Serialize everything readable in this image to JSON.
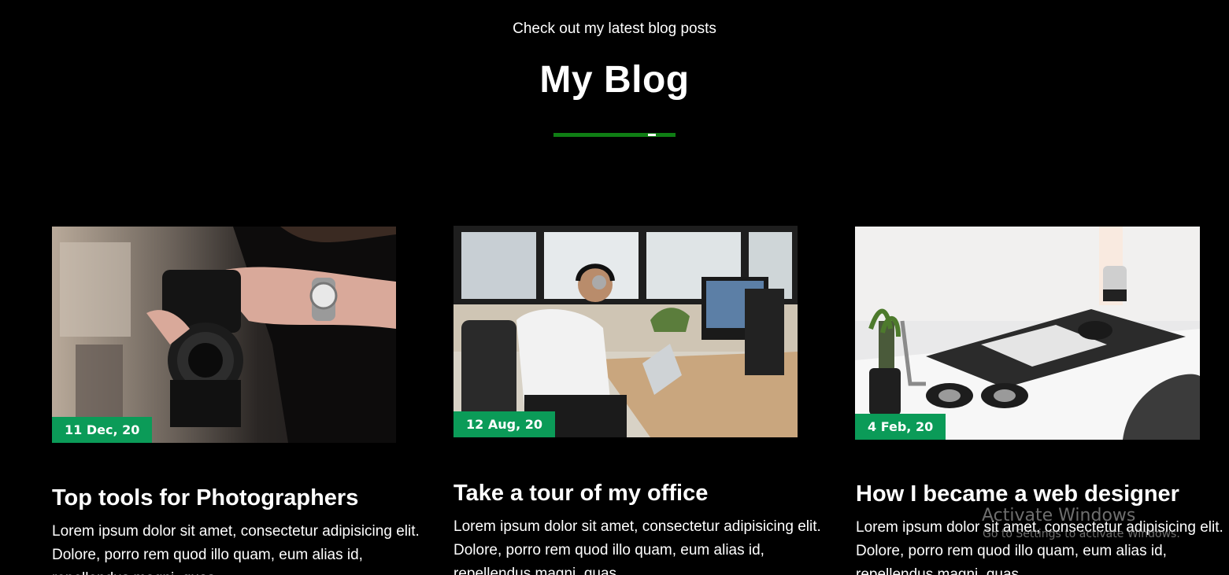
{
  "header": {
    "subtitle": "Check out my latest blog posts",
    "title": "My Blog"
  },
  "colors": {
    "background": "#000000",
    "accent_green": "#0f7e14",
    "badge_green": "#0b9b58"
  },
  "posts": [
    {
      "date": "11 Dec, 20",
      "title": "Top tools for Photographers",
      "body": "Lorem ipsum dolor sit amet, consectetur adipisicing elit. Dolore, porro rem quod illo quam, eum alias id, repellendus magni, quas.",
      "image_icon": "camera-photo"
    },
    {
      "date": "12 Aug, 20",
      "title": "Take a tour of my office",
      "body": "Lorem ipsum dolor sit amet, consectetur adipisicing elit. Dolore, porro rem quod illo quam, eum alias id, repellendus magni, quas.",
      "image_icon": "office-desk-photo"
    },
    {
      "date": "4 Feb, 20",
      "title": "How I became a web designer",
      "body": "Lorem ipsum dolor sit amet, consectetur adipisicing elit. Dolore, porro rem quod illo quam, eum alias id, repellendus magni, quas.",
      "image_icon": "laptop-desk-photo"
    }
  ],
  "watermark": {
    "title": "Activate Windows",
    "subtitle": "Go to Settings to activate Windows."
  }
}
